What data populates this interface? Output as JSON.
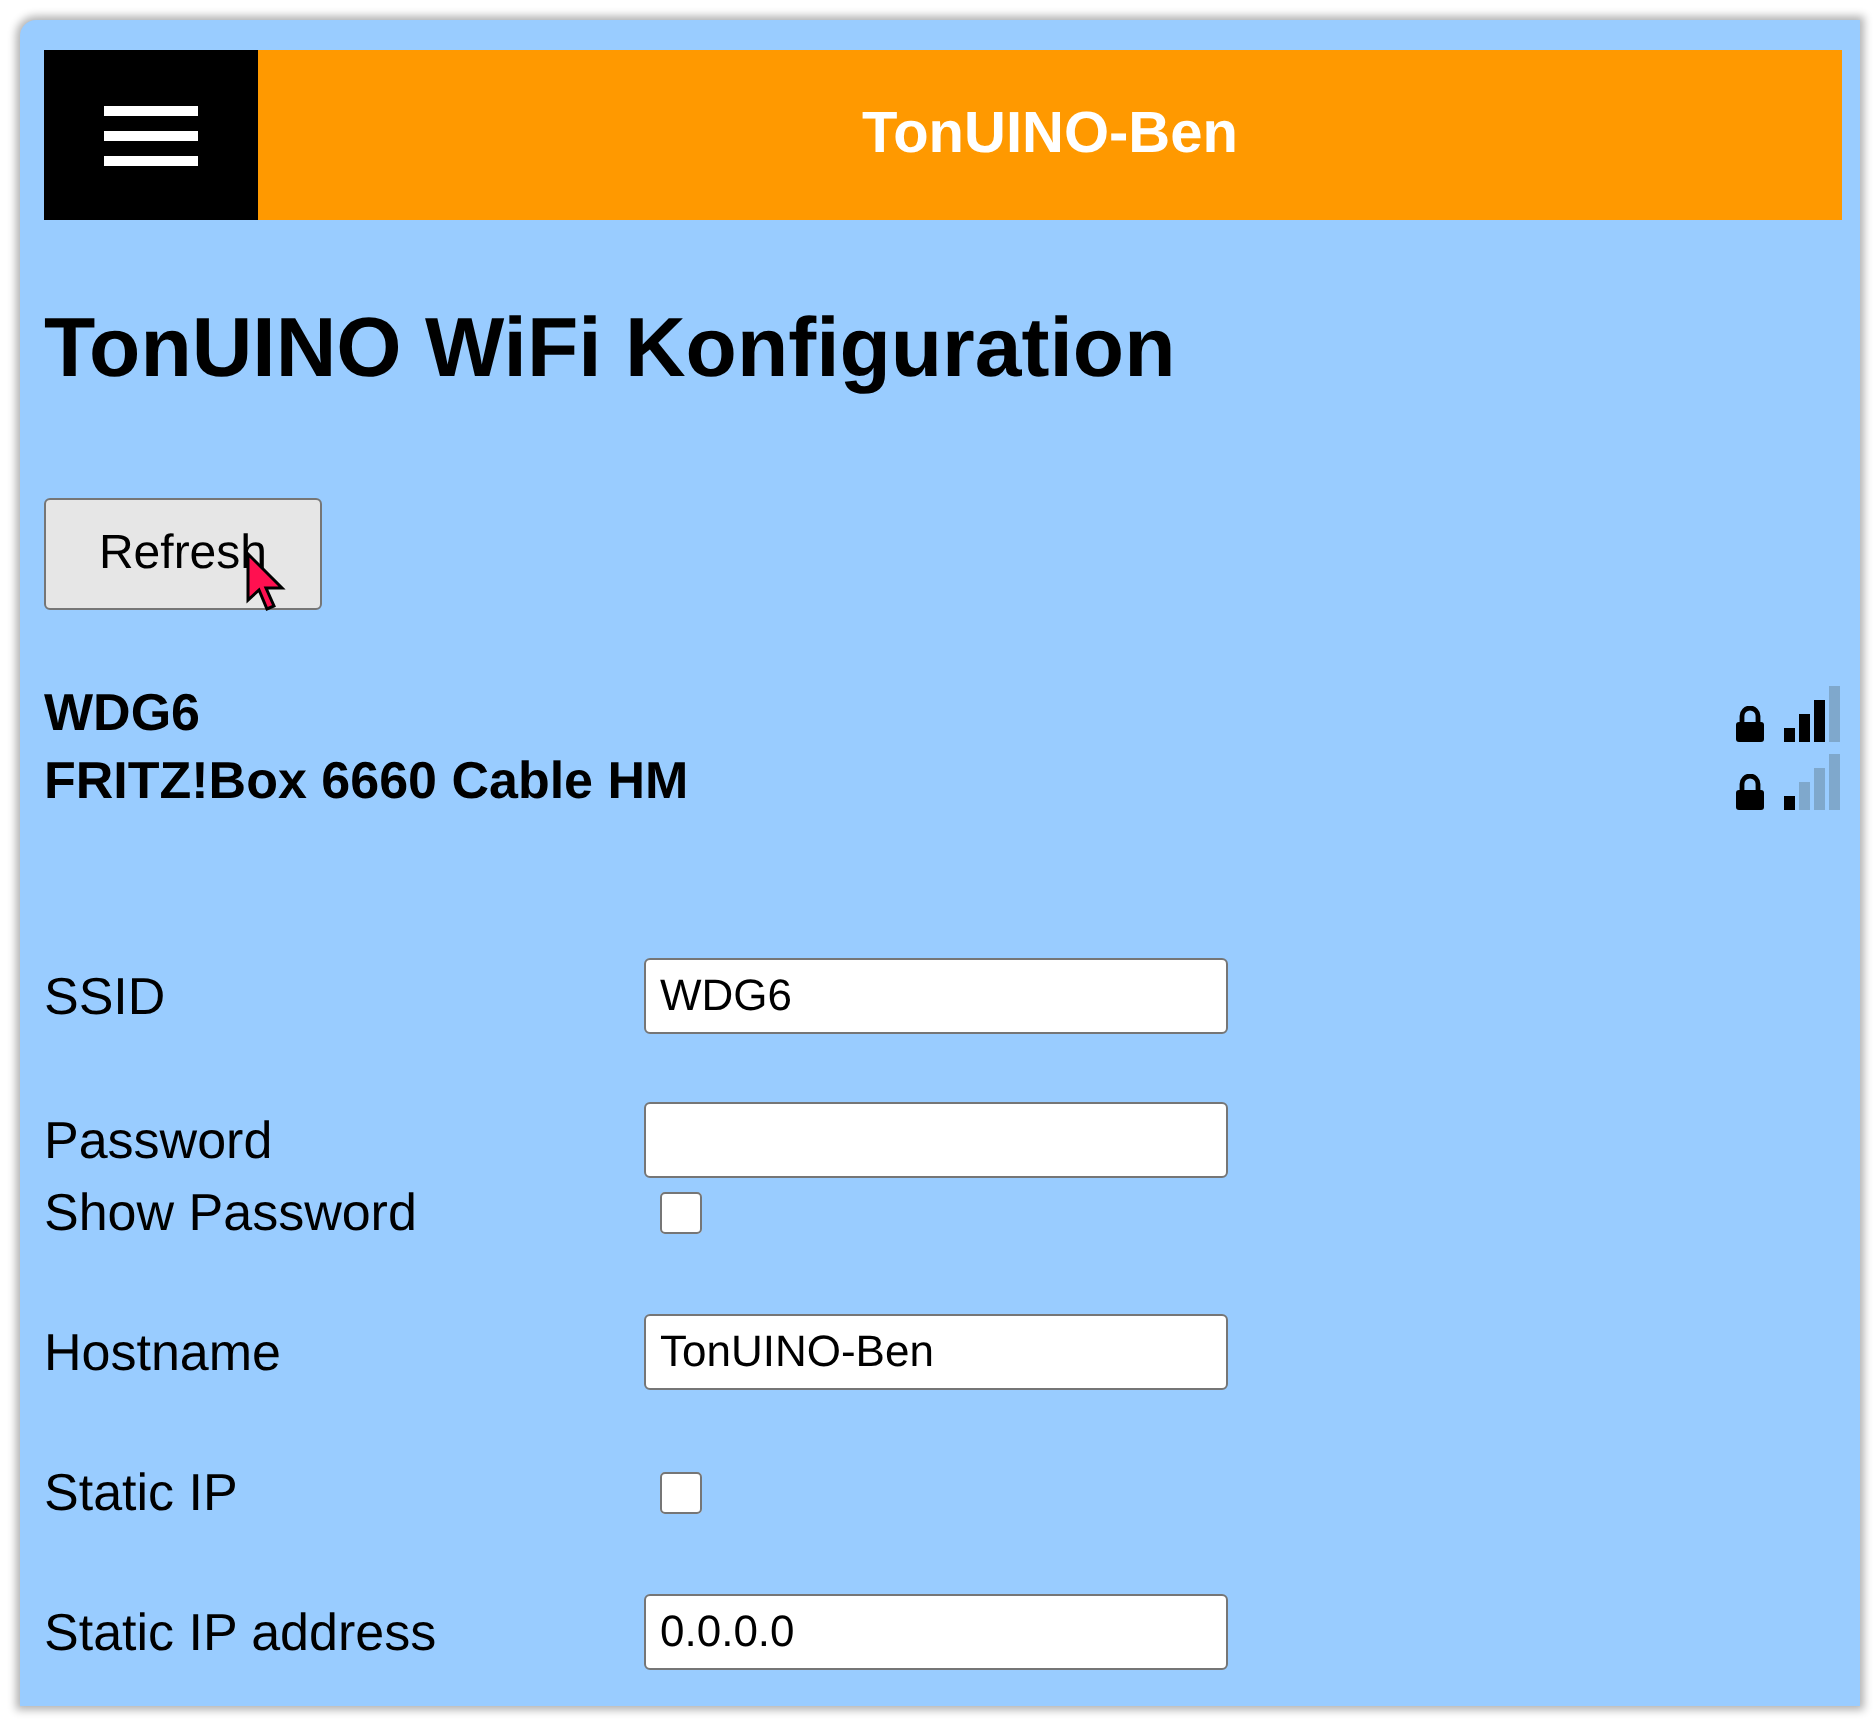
{
  "header": {
    "title": "TonUINO-Ben"
  },
  "page_title": "TonUINO WiFi Konfiguration",
  "refresh_button": "Refresh",
  "networks": [
    {
      "name": "WDG6",
      "secured": true,
      "weak_signal": false
    },
    {
      "name": "FRITZ!Box 6660 Cable HM",
      "secured": true,
      "weak_signal": true
    }
  ],
  "form": {
    "groups": [
      [
        {
          "kind": "text",
          "label": "SSID",
          "value": "WDG6"
        }
      ],
      [
        {
          "kind": "password",
          "label": "Password"
        },
        {
          "kind": "checkbox",
          "label": "Show Password",
          "checked": false
        }
      ],
      [
        {
          "kind": "text",
          "label": "Hostname",
          "value": "TonUINO-Ben"
        }
      ],
      [
        {
          "kind": "checkbox",
          "label": "Static IP",
          "checked": false
        }
      ],
      [
        {
          "kind": "text",
          "label": "Static IP address",
          "value": "0.0.0.0"
        }
      ]
    ]
  }
}
